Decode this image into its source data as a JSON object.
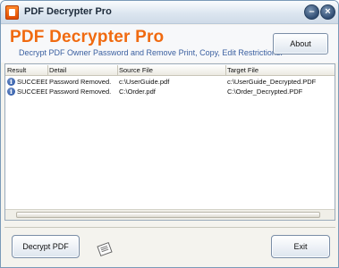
{
  "window": {
    "title": "PDF Decrypter Pro",
    "minimize_glyph": "–",
    "close_glyph": "×"
  },
  "header": {
    "app_name": "PDF Decrypter Pro",
    "tagline": "Decrypt PDF Owner Password and Remove Print, Copy, Edit  Restrictions.",
    "about_label": "About"
  },
  "table": {
    "columns": [
      "Result",
      "Detail",
      "Source File",
      "Target File"
    ],
    "rows": [
      {
        "result": "SUCCEED",
        "detail": "Password Removed.",
        "source": "c:\\UserGuide.pdf",
        "target": "c:\\UserGuide_Decrypted.PDF",
        "icon": "info-icon"
      },
      {
        "result": "SUCCEED",
        "detail": "Password Removed.",
        "source": "C:\\Order.pdf",
        "target": "C:\\Order_Decrypted.PDF",
        "icon": "info-icon"
      }
    ]
  },
  "footer": {
    "decrypt_label": "Decrypt PDF",
    "exit_label": "Exit"
  },
  "colors": {
    "brand_orange": "#f06a10",
    "tagline_blue": "#3a5fa0",
    "info_blue": "#1f4da0"
  }
}
